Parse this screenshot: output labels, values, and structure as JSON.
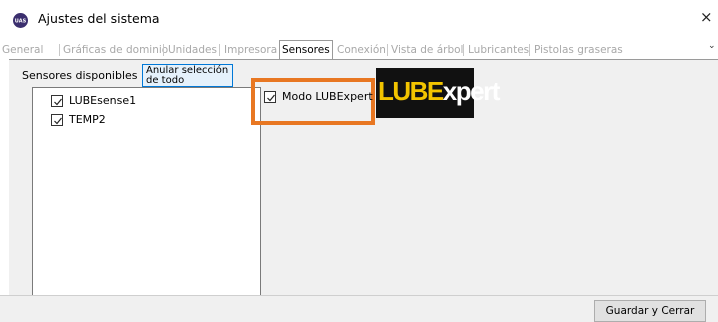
{
  "window": {
    "title": "Ajustes del sistema",
    "close_glyph": "×",
    "app_icon": "uas-logo-icon"
  },
  "tabs": [
    {
      "label": "General",
      "active": false
    },
    {
      "label": "Gráficas de dominio",
      "active": false
    },
    {
      "label": "Unidades",
      "active": false
    },
    {
      "label": "Impresora",
      "active": false
    },
    {
      "label": "Sensores",
      "active": true
    },
    {
      "label": "Conexión",
      "active": false
    },
    {
      "label": "Vista de árbol",
      "active": false
    },
    {
      "label": "Lubricantes",
      "active": false
    },
    {
      "label": "Pistolas graseras",
      "active": false
    }
  ],
  "sensors": {
    "label": "Sensores disponibles",
    "deselect_button": "Anular selección de todo",
    "items": [
      {
        "label": "LUBEsense1",
        "checked": true
      },
      {
        "label": "TEMP2",
        "checked": true
      }
    ]
  },
  "mode": {
    "label": "Modo LUBExpert",
    "checked": true
  },
  "logo": {
    "part1": "LUBE",
    "part2": "xpert"
  },
  "footer": {
    "save_button": "Guardar y Cerrar"
  },
  "colors": {
    "highlight": "#e87722",
    "logo_yellow": "#f2c400",
    "selection_blue": "#0078d7"
  }
}
